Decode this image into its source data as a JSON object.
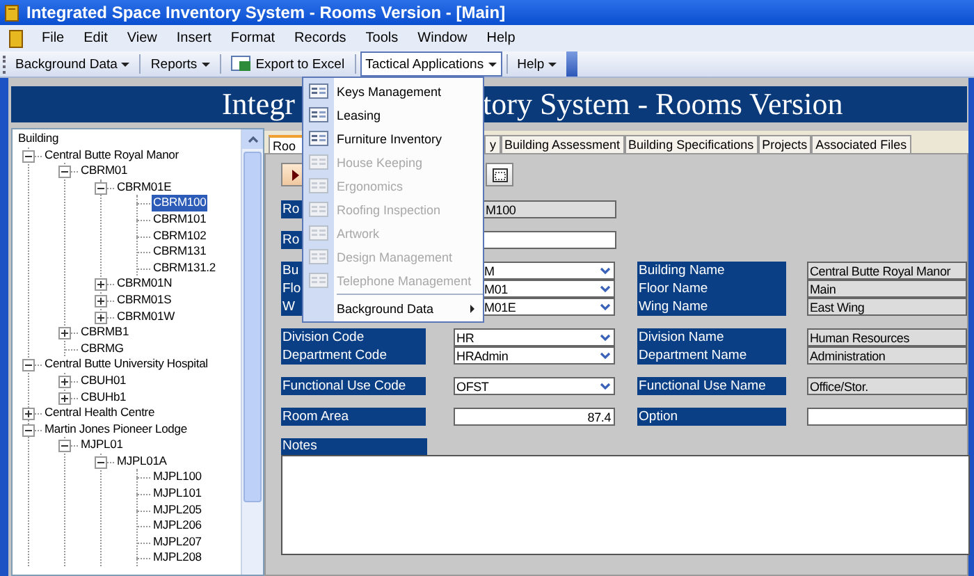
{
  "window": {
    "title": "Integrated Space Inventory System - Rooms Version - [Main]"
  },
  "menu_bar": [
    "File",
    "Edit",
    "View",
    "Insert",
    "Format",
    "Records",
    "Tools",
    "Window",
    "Help"
  ],
  "toolbar": [
    {
      "label": "Background Data",
      "kind": "dropdown",
      "selected": false
    },
    {
      "label": "Reports",
      "kind": "dropdown",
      "selected": false
    },
    {
      "label": "Export to Excel",
      "kind": "excel",
      "selected": false
    },
    {
      "label": "Tactical Applications",
      "kind": "dropdown",
      "selected": true
    },
    {
      "label": "Help",
      "kind": "dropdown",
      "selected": false
    }
  ],
  "banner": {
    "title_parts": [
      "Integr",
      "tory System - Rooms Version"
    ]
  },
  "tree": {
    "items": [
      {
        "label": "Building",
        "selected": false,
        "children": [
          {
            "label": "Central Butte Royal Manor",
            "expanded": true,
            "selected": false,
            "children": [
              {
                "label": "CBRM01",
                "expanded": true,
                "selected": false,
                "children": [
                  {
                    "label": "CBRM01E",
                    "expanded": true,
                    "selected": false,
                    "children": [
                      {
                        "label": "CBRM100",
                        "selected": true
                      },
                      {
                        "label": "CBRM101",
                        "selected": false
                      },
                      {
                        "label": "CBRM102",
                        "selected": false
                      },
                      {
                        "label": "CBRM131",
                        "selected": false
                      },
                      {
                        "label": "CBRM131.2",
                        "selected": false
                      }
                    ]
                  },
                  {
                    "label": "CBRM01N",
                    "expanded": false,
                    "selected": false
                  },
                  {
                    "label": "CBRM01S",
                    "expanded": false,
                    "selected": false
                  },
                  {
                    "label": "CBRM01W",
                    "expanded": false,
                    "selected": false
                  }
                ]
              },
              {
                "label": "CBRMB1",
                "expanded": false,
                "selected": false
              },
              {
                "label": "CBRMG",
                "selected": false
              }
            ]
          },
          {
            "label": "Central Butte University Hospital",
            "expanded": true,
            "selected": false,
            "children": [
              {
                "label": "CBUH01",
                "expanded": false,
                "selected": false
              },
              {
                "label": "CBUHb1",
                "expanded": false,
                "selected": false
              }
            ]
          },
          {
            "label": "Central Health Centre",
            "expanded": false,
            "selected": false
          },
          {
            "label": "Martin Jones Pioneer Lodge",
            "expanded": true,
            "selected": false,
            "children": [
              {
                "label": "MJPL01",
                "expanded": true,
                "selected": false,
                "children": [
                  {
                    "label": "MJPL01A",
                    "expanded": true,
                    "selected": false,
                    "children": [
                      {
                        "label": "MJPL100",
                        "selected": false
                      },
                      {
                        "label": "MJPL101",
                        "selected": false
                      },
                      {
                        "label": "MJPL205",
                        "selected": false
                      },
                      {
                        "label": "MJPL206",
                        "selected": false
                      },
                      {
                        "label": "MJPL207",
                        "selected": false
                      },
                      {
                        "label": "MJPL208",
                        "selected": false
                      }
                    ]
                  }
                ]
              }
            ]
          }
        ]
      }
    ]
  },
  "tabs": [
    {
      "label": "Roo",
      "selected": true
    },
    {
      "label": "y",
      "selected": false
    },
    {
      "label": "Building Assessment",
      "selected": false
    },
    {
      "label": "Building Specifications",
      "selected": false
    },
    {
      "label": "Projects",
      "selected": false
    },
    {
      "label": "Associated Files",
      "selected": false
    }
  ],
  "form": {
    "groups": [
      {
        "rows": [
          {
            "label": "Ro",
            "field": {
              "kind": "readonly",
              "value": "M100"
            }
          }
        ]
      },
      {
        "rows": [
          {
            "label": "Ro",
            "field": {
              "kind": "text"
            }
          }
        ]
      },
      {
        "rows": [
          {
            "label": "Bu",
            "field": {
              "kind": "combo",
              "value": "M"
            },
            "name_label": "Building Name",
            "name_field": {
              "kind": "readonly",
              "value": "Central Butte Royal Manor"
            }
          },
          {
            "label": "Flo",
            "field": {
              "kind": "combo",
              "value": "M01"
            },
            "name_label": "Floor Name",
            "name_field": {
              "kind": "readonly",
              "value": "Main"
            }
          },
          {
            "label": "W",
            "field": {
              "kind": "combo",
              "value": "M01E"
            },
            "name_label": "Wing Name",
            "name_field": {
              "kind": "readonly",
              "value": "East Wing"
            }
          }
        ]
      },
      {
        "rows": [
          {
            "label": "Division Code",
            "field": {
              "kind": "combo",
              "value": "HR"
            },
            "name_label": "Division Name",
            "name_field": {
              "kind": "readonly",
              "value": "Human Resources"
            }
          },
          {
            "label": "Department Code",
            "field": {
              "kind": "combo",
              "value": "HRAdmin"
            },
            "name_label": "Department Name",
            "name_field": {
              "kind": "readonly",
              "value": "Administration"
            }
          }
        ]
      },
      {
        "rows": [
          {
            "label": "Functional Use Code",
            "field": {
              "kind": "combo",
              "value": "OFST"
            },
            "name_label": "Functional Use Name",
            "name_field": {
              "kind": "readonly",
              "value": "Office/Stor."
            }
          }
        ]
      },
      {
        "rows": [
          {
            "label": "Room Area",
            "field": {
              "kind": "number",
              "value": "87.4"
            },
            "name_label": "Option",
            "name_field": {
              "kind": "text"
            }
          }
        ]
      }
    ],
    "notes_label": "Notes"
  },
  "dropdown_menu": {
    "items": [
      {
        "label": "Keys Management",
        "kind": "item",
        "disabled": false
      },
      {
        "label": "Leasing",
        "kind": "item",
        "disabled": false
      },
      {
        "label": "Furniture Inventory",
        "kind": "item",
        "disabled": false
      },
      {
        "label": "House Keeping",
        "kind": "item",
        "disabled": true
      },
      {
        "label": "Ergonomics",
        "kind": "item",
        "disabled": true
      },
      {
        "label": "Roofing Inspection",
        "kind": "item",
        "disabled": true
      },
      {
        "label": "Artwork",
        "kind": "item",
        "disabled": true
      },
      {
        "label": "Design Management",
        "kind": "item",
        "disabled": true
      },
      {
        "label": "Telephone Management",
        "kind": "item",
        "disabled": true
      },
      {
        "label": "Background Data",
        "kind": "submenu",
        "disabled": false
      }
    ]
  }
}
